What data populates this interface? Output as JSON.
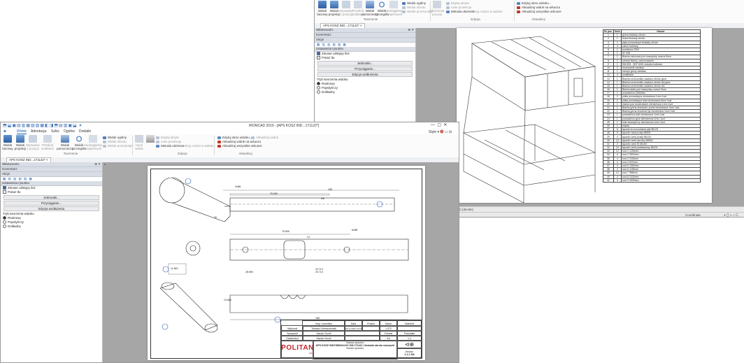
{
  "app": {
    "title": "IRONCAD 2010 - [APS KOSZ IND...171122*]",
    "style_label": "Style",
    "tabs": [
      "Widok",
      "Adnotacja",
      "Szkic",
      "Ogólne",
      "Dodatki"
    ],
    "active_tab": "Widok"
  },
  "ribbon": {
    "row1": [
      "Widok bazowy",
      "Widok projekcji",
      "Wyrwanie z pozycji",
      "Przekrój szablonu",
      "Widok pomocniczy",
      "Widok szczegółu",
      "Zaokrąglenie wzajemnych"
    ],
    "group1": "Tworzenie",
    "view_options": [
      "Widok ogólny",
      "Widok obrotu",
      "Widok przesunięty"
    ],
    "view_options_short": [
      "Widok ogólny",
      "Widok obrotu",
      "Widok przesunięty"
    ],
    "obrocenie": "Obrócenie pozycji",
    "usun_widok": "Usuń widok",
    "linie_przekroju": "Linie przekroju",
    "metoda": "Metoda ułożenia",
    "ukryj": "Ukryj części w widoku",
    "group2": "Edycja",
    "edit_options": [
      "Edytuj ukryte",
      "Linie przekroju",
      "Metoda ułożenia",
      "Ukryj części w widoku"
    ],
    "aktualizacja": [
      "Edytuj okno widoku...",
      "Aktualizuj widok na arkuszu",
      "Aktualizuj wszystkie arkusze"
    ],
    "aktualizuj_widok": "Aktualizuj widok",
    "group3": "Aktualizuj"
  },
  "doc_tab": "APS KOSZ IND...171122*",
  "panel": {
    "title": "Właściwości",
    "sections": [
      "Komentarz",
      "Akcje"
    ],
    "settings_title": "Ustawienia rysunku",
    "checks": [
      {
        "label": "Zetowe odstępy linii",
        "on": true
      },
      {
        "label": "Pokaż tło",
        "on": false
      }
    ],
    "buttons": [
      "Jednostki...",
      "Przyciąganie...",
      "Edycja wzdłużenia"
    ],
    "mode_title": "Tryb tworzenia widoku",
    "modes": [
      {
        "label": "Rastrowy",
        "on": true
      },
      {
        "label": "Pojedyńczy",
        "on": false
      },
      {
        "label": "Dokładny",
        "on": false
      }
    ]
  },
  "drawing1": {
    "dims": [
      "188",
      "76.206",
      "3xØ5",
      "30",
      "76.595",
      "14",
      "20.714",
      "188",
      "Ø8",
      "28.595",
      "11.663",
      "13.659",
      "29.714",
      "8xØ5"
    ],
    "balloons": [
      "1",
      "2",
      "3",
      "4",
      "5"
    ],
    "titleblock": {
      "headers": [
        "Imię i nazwisko",
        "Data",
        "Podpis",
        "Masa",
        "Materiał"
      ],
      "rows": [
        [
          "Wykonał",
          "Tomasz Grebaczewski",
          "25.11.2022 10:43",
          "",
          "1.072",
          ""
        ],
        [
          "Sprawdził",
          "Marcin Szroll",
          "",
          "",
          "Format",
          "Podziałka"
        ],
        [
          "Zatwierdził",
          "Marcin Szroll",
          "",
          "",
          "A4",
          "1:1"
        ]
      ],
      "project_label": "Nazwa rysunku:",
      "project_name": "APS KOSZ INDYWIDUALNY DM 171122 / blokada obrotu maszynki",
      "number_label": "Numer rysunku:",
      "arkusz_label": "Arkusz:",
      "sheet_no": "1.2.1 5/8",
      "logo": "POLITAN",
      "logo_year": "1982"
    }
  },
  "drawing2": {
    "parts_header": [
      "Nr poz.",
      "Ilość",
      "Nazwa"
    ],
    "parts": [
      [
        "1",
        "1",
        "górna blokady obrotu"
      ],
      [
        "2",
        "1",
        "dolna blokady obrotu"
      ],
      [
        "3",
        "1",
        "płyta prowadząca blokady obrotu"
      ],
      [
        "4",
        "4",
        "zawór kablowy"
      ],
      [
        "5",
        "1",
        "przesłona 230V"
      ],
      [
        "6",
        "1",
        "SF-528"
      ],
      [
        "7",
        "1",
        "Blacha osłonowa pod maszynkę czarna 5mm"
      ],
      [
        "8",
        "2",
        "uchwyt blachy, zamocowanie"
      ],
      [
        "9",
        "1",
        "DM 625 - SKF 6001 łożysko kulkowe"
      ],
      [
        "10",
        "2",
        "mocowanie zawiasu"
      ],
      [
        "11",
        "1",
        "uchwyt górny zawiasu"
      ],
      [
        "12",
        "4",
        "podkładka"
      ],
      [
        "13",
        "1",
        "Blacha na teowniku zawiasu obrotu góra"
      ],
      [
        "14",
        "1",
        "Blacha na teowniku zawiasu obrotu dół góra"
      ],
      [
        "15",
        "1",
        "Blacha na teowniku zawiasu obrotu dół"
      ],
      [
        "16",
        "1",
        "Blacha stała pod maszynkę czarna 3mm"
      ],
      [
        "17",
        "1",
        "prowadnica 1660x5m"
      ],
      [
        "18",
        "2",
        "półka prowadząca nierdzewna 1mm 1szt"
      ],
      [
        "19",
        "2",
        "półka prowadząca boki nierdzewna 5mm 2szt"
      ],
      [
        "20",
        "1",
        "blacha pod drzwiczkami nierdzewna 1mm 1szt"
      ],
      [
        "21",
        "1",
        "Blacha górna drzwiczki, przód nierdzewna 1mm 1szt"
      ],
      [
        "22",
        "1",
        "Blacha górna drzwiczki tył nierdzewna 1mm 1szt"
      ],
      [
        "23",
        "1",
        "prowadnica boki nierdzewna 1mm 1szt"
      ],
      [
        "24",
        "1",
        "prowadnica góra nierdzewna 1mm 1szt"
      ],
      [
        "25",
        "1",
        "boki wewnętrzny nierdzewna 1mm 2szt"
      ],
      [
        "26",
        "1",
        "stopka"
      ],
      [
        "27",
        "6",
        "łącznik do mocowania płyt 86123"
      ],
      [
        "28",
        "5",
        "łącznik rurek prosty 86501"
      ],
      [
        "29",
        "4",
        "łącznik rurek prosty 86104"
      ],
      [
        "30",
        "10",
        "łącznik rurek narożny 86502"
      ],
      [
        "31",
        "2",
        "łącznik rurek 90 86165"
      ],
      [
        "32",
        "19",
        "łącznik rurek podstawowy 86124"
      ],
      [
        "33",
        "12",
        "rura 1 1256mm"
      ],
      [
        "34",
        "4",
        "rura 2 3503mm"
      ],
      [
        "35",
        "4",
        "rura 3 1115mm"
      ],
      [
        "36",
        "4",
        "rura 4 922mm"
      ],
      [
        "37",
        "2",
        "rura 5 1052mm"
      ],
      [
        "38",
        "2",
        "rura 6 1155mm"
      ],
      [
        "39",
        "12",
        "rura 7 388mm"
      ],
      [
        "40",
        "4",
        "rura 8 2434mm"
      ],
      [
        "41",
        "4",
        "rura 9 2539mm"
      ]
    ],
    "status_text": "1 : 6.35  11.52  (dispened)  (wall)  (decals)",
    "coord_label": "Coordinate"
  },
  "colors": {
    "accent": "#1b5fb0",
    "canvas": "#a6a6a6",
    "panel_head": "#d9dee6"
  }
}
